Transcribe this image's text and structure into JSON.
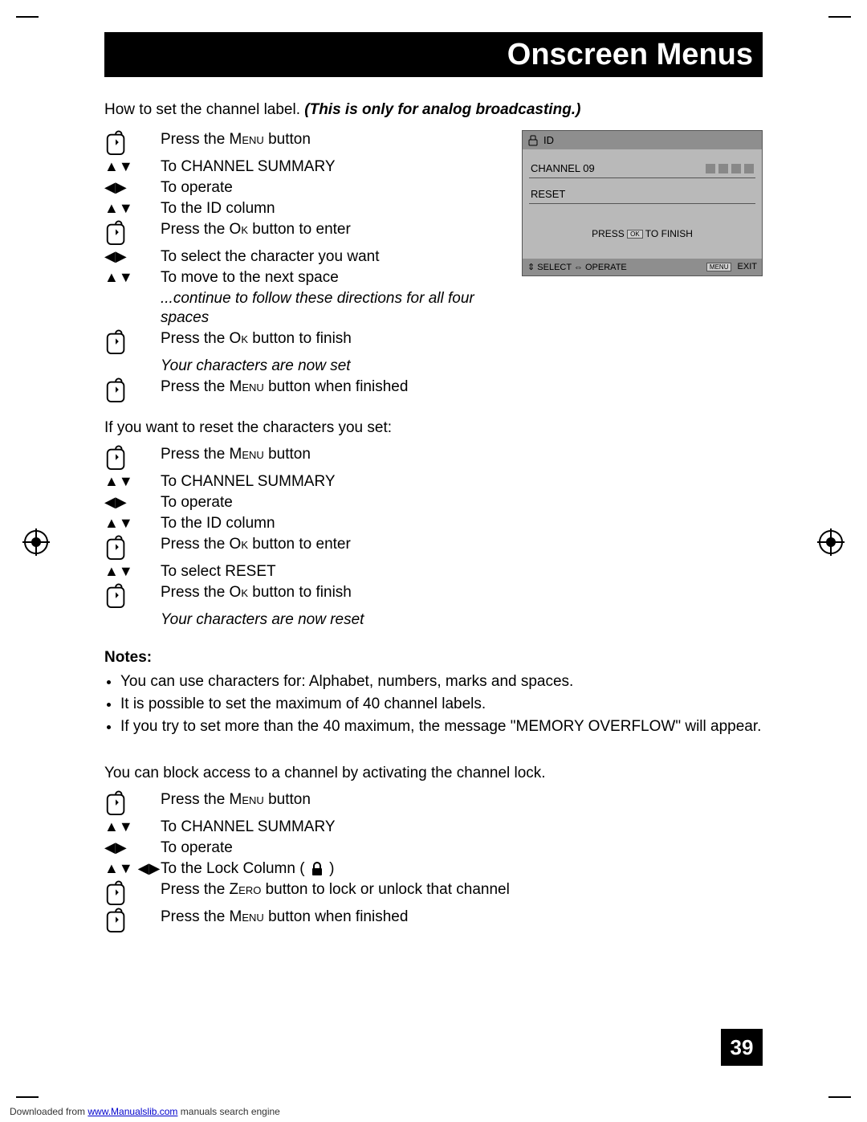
{
  "header": {
    "title": "Onscreen Menus"
  },
  "intro1": {
    "lead": "How to set the channel label.  ",
    "note": "(This is only for analog broadcasting.)"
  },
  "steps1": [
    {
      "icon": "remote",
      "text": "Press the <span class='sc'>Menu</span> button"
    },
    {
      "icon": "ud",
      "text": "To CHANNEL SUMMARY"
    },
    {
      "icon": "lr",
      "text": "To operate"
    },
    {
      "icon": "ud",
      "text": "To the ID column"
    },
    {
      "icon": "remote",
      "text": "Press the <span class='sc'>Ok</span> button to enter"
    },
    {
      "icon": "lr",
      "text": "To select the character you want"
    },
    {
      "icon": "ud",
      "text": "To move to the next space"
    },
    {
      "icon": "none",
      "text": "<em>...continue to follow these directions for all four spaces</em>"
    },
    {
      "icon": "remote",
      "text": "Press the <span class='sc'>Ok</span> button to finish"
    },
    {
      "icon": "none",
      "text": "<em>Your characters are now set</em>"
    },
    {
      "icon": "remote",
      "text": "Press the <span class='sc'>Menu</span> button when finished"
    }
  ],
  "subhead_reset": "If you want to reset the characters you set:",
  "steps2": [
    {
      "icon": "remote",
      "text": "Press the <span class='sc'>Menu</span> button"
    },
    {
      "icon": "ud",
      "text": "To CHANNEL SUMMARY"
    },
    {
      "icon": "lr",
      "text": "To operate"
    },
    {
      "icon": "ud",
      "text": "To the ID column"
    },
    {
      "icon": "remote",
      "text": "Press the <span class='sc'>Ok</span> button to enter"
    },
    {
      "icon": "ud",
      "text": "To select RESET"
    },
    {
      "icon": "remote",
      "text": "Press the <span class='sc'>Ok</span> button to finish"
    },
    {
      "icon": "none",
      "text": "<em>Your characters are now reset</em>"
    }
  ],
  "notes_head": "Notes:",
  "notes": [
    "You can use characters for: Alphabet, numbers, marks and spaces.",
    "It is possible to set the maximum of 40 channel labels.",
    "If you try to set more than the 40 maximum, the message \"MEMORY OVERFLOW\" will appear."
  ],
  "subhead_lock": "You can block access to a channel by activating the channel lock.",
  "steps3": [
    {
      "icon": "remote",
      "text": "Press the <span class='sc'>Menu</span> button"
    },
    {
      "icon": "ud",
      "text": "To CHANNEL SUMMARY"
    },
    {
      "icon": "lr",
      "text": "To operate"
    },
    {
      "icon": "udlr",
      "text": "To the Lock Column ( {LOCK} )"
    },
    {
      "icon": "remote",
      "text": "Press the <span class='sc'>Zero</span> button to lock or unlock that channel"
    },
    {
      "icon": "remote",
      "text": "Press the <span class='sc'>Menu</span> button when finished"
    }
  ],
  "osd": {
    "title": "ID",
    "channel_label": "CHANNEL 09",
    "reset_label": "RESET",
    "hint_pre": "PRESS",
    "hint_ok": "OK",
    "hint_post": "TO FINISH",
    "foot_select": "SELECT",
    "foot_operate": "OPERATE",
    "foot_menu": "MENU",
    "foot_exit": "EXIT"
  },
  "page_number": "39",
  "footer": {
    "pre": "Downloaded from ",
    "link": "www.Manualslib.com",
    "post": " manuals search engine"
  }
}
